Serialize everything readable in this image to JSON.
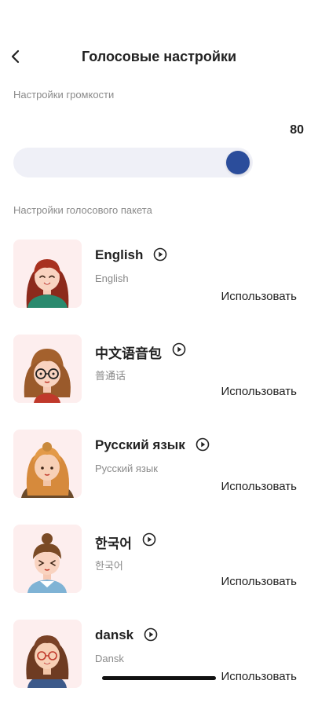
{
  "header": {
    "title": "Голосовые настройки",
    "back_icon": "chevron-left-icon"
  },
  "volume": {
    "section_label": "Настройки громкости",
    "value": "80",
    "level_percent": 80,
    "knob_color": "#2b4d9b",
    "track_color": "#eff0f7"
  },
  "voice_pack": {
    "section_label": "Настройки голосового пакета",
    "items": [
      {
        "name": "English",
        "subtitle": "English",
        "action": "Использовать",
        "avatar": "avatar-english"
      },
      {
        "name": "中文语音包",
        "subtitle": "普通话",
        "action": "Использовать",
        "avatar": "avatar-chinese"
      },
      {
        "name": "Русский язык",
        "subtitle": "Русский язык",
        "action": "Использовать",
        "avatar": "avatar-russian"
      },
      {
        "name": "한국어",
        "subtitle": "한국어",
        "action": "Использовать",
        "avatar": "avatar-korean"
      },
      {
        "name": "dansk",
        "subtitle": "Dansk",
        "action": "Использовать",
        "avatar": "avatar-danish"
      }
    ]
  },
  "colors": {
    "avatar_bg": "#fdeeee",
    "accent": "#2b4d9b",
    "muted_text": "#8a8a8a"
  }
}
